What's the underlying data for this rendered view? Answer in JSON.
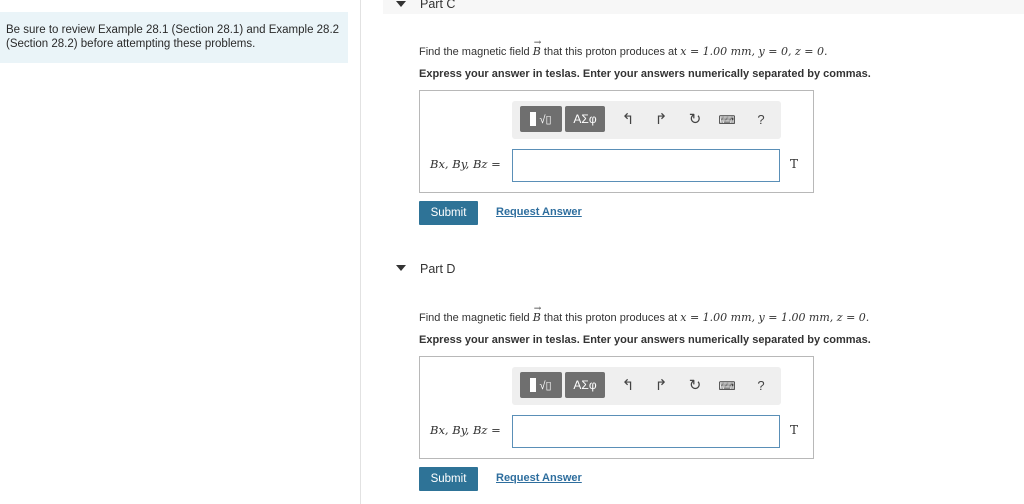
{
  "sidebar": {
    "note": "Be sure to review Example 28.1 (Section 28.1) and Example 28.2 (Section 28.2) before attempting these problems."
  },
  "parts": [
    {
      "title": "Part C",
      "prompt_prefix": "Find the magnetic field",
      "field_symbol": "B",
      "prompt_mid": "that this proton produces at",
      "coords": "x = 1.00 mm, y = 0, z = 0.",
      "instruction": "Express your answer in teslas. Enter your answers numerically separated by commas.",
      "var_label": "Bx, By, Bz =",
      "unit": "T",
      "input_value": "",
      "submit_label": "Submit",
      "request_label": "Request Answer"
    },
    {
      "title": "Part D",
      "prompt_prefix": "Find the magnetic field",
      "field_symbol": "B",
      "prompt_mid": "that this proton produces at",
      "coords": "x = 1.00 mm, y = 1.00 mm, z = 0.",
      "instruction": "Express your answer in teslas. Enter your answers numerically separated by commas.",
      "var_label": "Bx, By, Bz =",
      "unit": "T",
      "input_value": "",
      "submit_label": "Submit",
      "request_label": "Request Answer"
    }
  ],
  "toolbar": {
    "greek_label": "ΑΣφ",
    "help_label": "?",
    "icons": [
      "templates-icon",
      "greek-symbols-icon",
      "undo-icon",
      "redo-icon",
      "reset-icon",
      "keyboard-icon",
      "help-icon"
    ]
  }
}
